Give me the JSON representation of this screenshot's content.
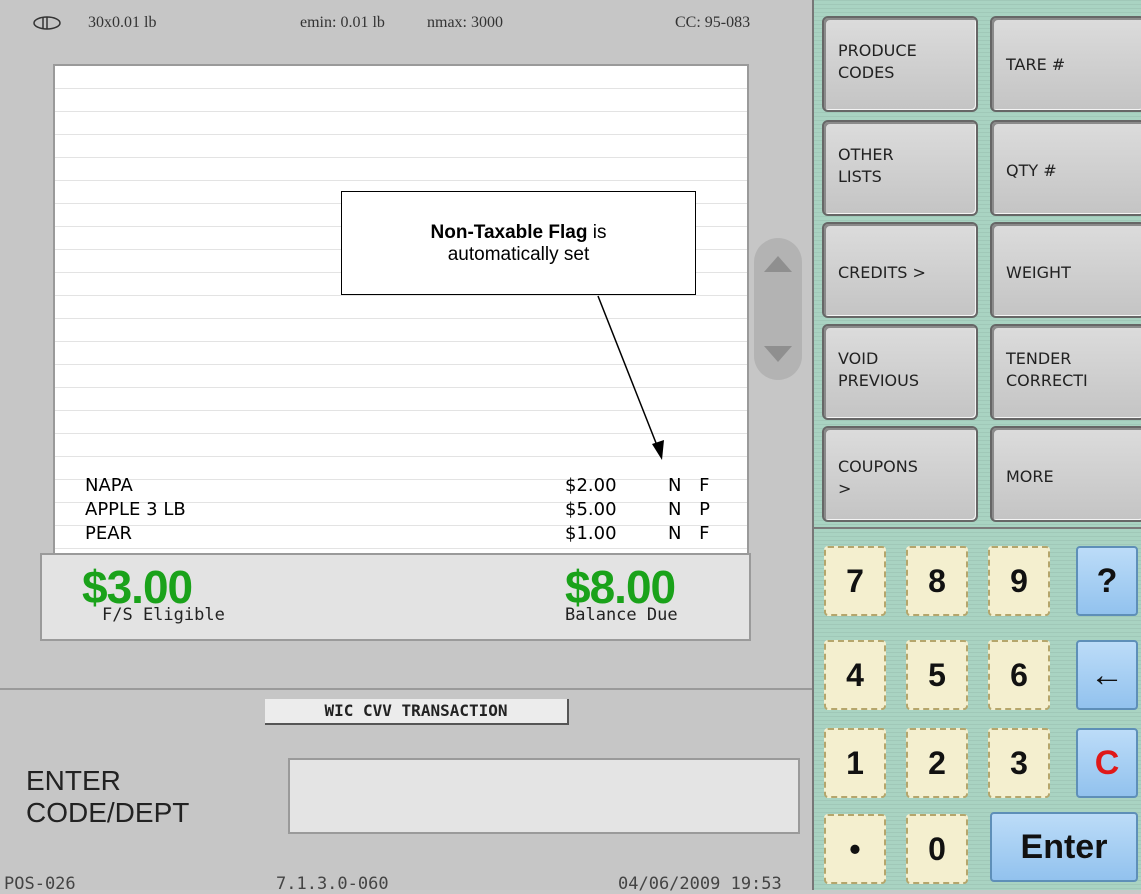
{
  "scale_info": {
    "capacity": "30x0.01 lb",
    "emin": "emin: 0.01 lb",
    "nmax": "nmax: 3000",
    "cc": "CC: 95-083"
  },
  "items": [
    {
      "desc": "NAPA",
      "price": "$2.00",
      "flags": "N F"
    },
    {
      "desc": "APPLE 3 LB",
      "price": "$5.00",
      "flags": "N P"
    },
    {
      "desc": "PEAR",
      "price": "$1.00",
      "flags": "N F"
    }
  ],
  "totals": {
    "fs_amount": "$3.00",
    "fs_label": "F/S Eligible",
    "balance_amount": "$8.00",
    "balance_label": "Balance Due"
  },
  "transaction_tab": "WIC CVV TRANSACTION",
  "prompt": {
    "line1": "ENTER",
    "line2": "CODE/DEPT"
  },
  "status": {
    "terminal": "POS-026",
    "version": "7.1.3.0-060",
    "datetime": "04/06/2009 19:53"
  },
  "callout": {
    "bold": "Non-Taxable Flag",
    "rest1": " is",
    "rest2": "automatically set"
  },
  "function_keys": [
    {
      "line1": "PRODUCE",
      "line2": "CODES"
    },
    {
      "line1": "TARE #",
      "line2": ""
    },
    {
      "line1": "OTHER",
      "line2": "LISTS"
    },
    {
      "line1": "QTY #",
      "line2": ""
    },
    {
      "line1": "CREDITS >",
      "line2": ""
    },
    {
      "line1": "WEIGHT",
      "line2": ""
    },
    {
      "line1": "VOID",
      "line2": "PREVIOUS"
    },
    {
      "line1": "TENDER",
      "line2": "CORRECTI"
    },
    {
      "line1": "COUPONS",
      "line2": ">"
    },
    {
      "line1": "MORE",
      "line2": ""
    }
  ],
  "keypad": {
    "k7": "7",
    "k8": "8",
    "k9": "9",
    "help": "?",
    "k4": "4",
    "k5": "5",
    "k6": "6",
    "back": "←",
    "k1": "1",
    "k2": "2",
    "k3": "3",
    "clear": "C",
    "dot": "•",
    "k0": "0",
    "enter": "Enter"
  },
  "colors": {
    "total_green": "#1aa21a",
    "right_panel": "#a9d3c2",
    "clear_red": "#e01818"
  }
}
